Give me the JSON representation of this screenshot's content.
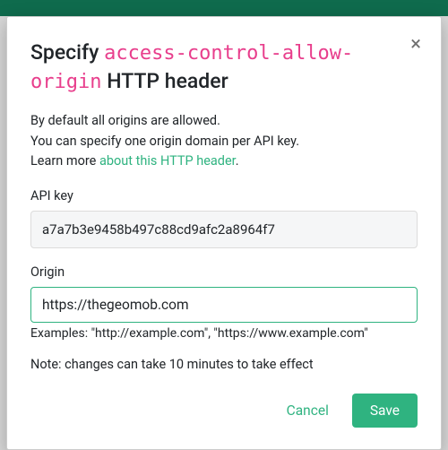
{
  "modal": {
    "title_prefix": "Specify ",
    "title_code": "access-control-allow-origin",
    "title_suffix": " HTTP header",
    "close_glyph": "×",
    "desc_line1": "By default all origins are allowed.",
    "desc_line2": "You can specify one origin domain per API key.",
    "desc_learn_prefix": "Learn more ",
    "desc_learn_link": "about this HTTP header",
    "desc_learn_suffix": ".",
    "apikey_label": "API key",
    "apikey_value": "a7a7b3e9458b497c88cd9afc2a8964f7",
    "origin_label": "Origin",
    "origin_value": "https://thegeomob.com",
    "examples_text": "Examples: \"http://example.com\", \"https://www.example.com\"",
    "note_text": "Note: changes can take 10 minutes to take effect",
    "cancel_label": "Cancel",
    "save_label": "Save"
  }
}
